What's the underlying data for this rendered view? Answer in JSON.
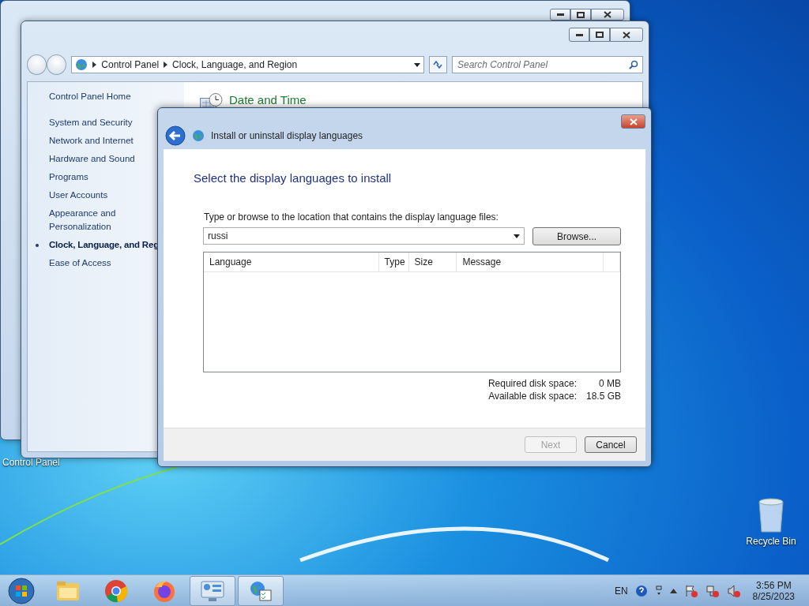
{
  "desktop": {
    "covered_icon_label": "Control Panel",
    "recycle_bin": {
      "label": "Recycle Bin"
    }
  },
  "control_panel": {
    "address": {
      "breadcrumbs": [
        "Control Panel",
        "Clock, Language, and Region"
      ]
    },
    "search": {
      "placeholder": "Search Control Panel"
    },
    "sidebar": {
      "home": "Control Panel Home",
      "items": [
        {
          "label": "System and Security",
          "selected": false
        },
        {
          "label": "Network and Internet",
          "selected": false
        },
        {
          "label": "Hardware and Sound",
          "selected": false
        },
        {
          "label": "Programs",
          "selected": false
        },
        {
          "label": "User Accounts",
          "selected": false
        },
        {
          "label": "Appearance and Personalization",
          "selected": false
        },
        {
          "label": "Clock, Language, and Reg",
          "selected": true
        },
        {
          "label": "Ease of Access",
          "selected": false
        }
      ]
    },
    "category": {
      "title": "Date and Time"
    }
  },
  "dialog": {
    "title": "Install or uninstall display languages",
    "heading": "Select the display languages to install",
    "location_label": "Type or browse to the location that contains the display language files:",
    "location_value": "russi",
    "browse": "Browse...",
    "columns": [
      "Language",
      "Type",
      "Size",
      "Message"
    ],
    "disk": [
      {
        "label": "Required disk space:",
        "value": "0 MB"
      },
      {
        "label": "Available disk space:",
        "value": "18.5 GB"
      }
    ],
    "buttons": [
      {
        "label": "Next",
        "disabled": true
      },
      {
        "label": "Cancel",
        "disabled": false
      }
    ]
  },
  "taskbar": {
    "items": [
      {
        "kind": "explorer",
        "active": false
      },
      {
        "kind": "chrome",
        "active": false
      },
      {
        "kind": "firefox",
        "active": false
      },
      {
        "kind": "control-panel",
        "active": true
      },
      {
        "kind": "language",
        "active": true
      }
    ],
    "tray": {
      "language": "EN",
      "time": "3:56 PM",
      "date": "8/25/2023"
    }
  }
}
